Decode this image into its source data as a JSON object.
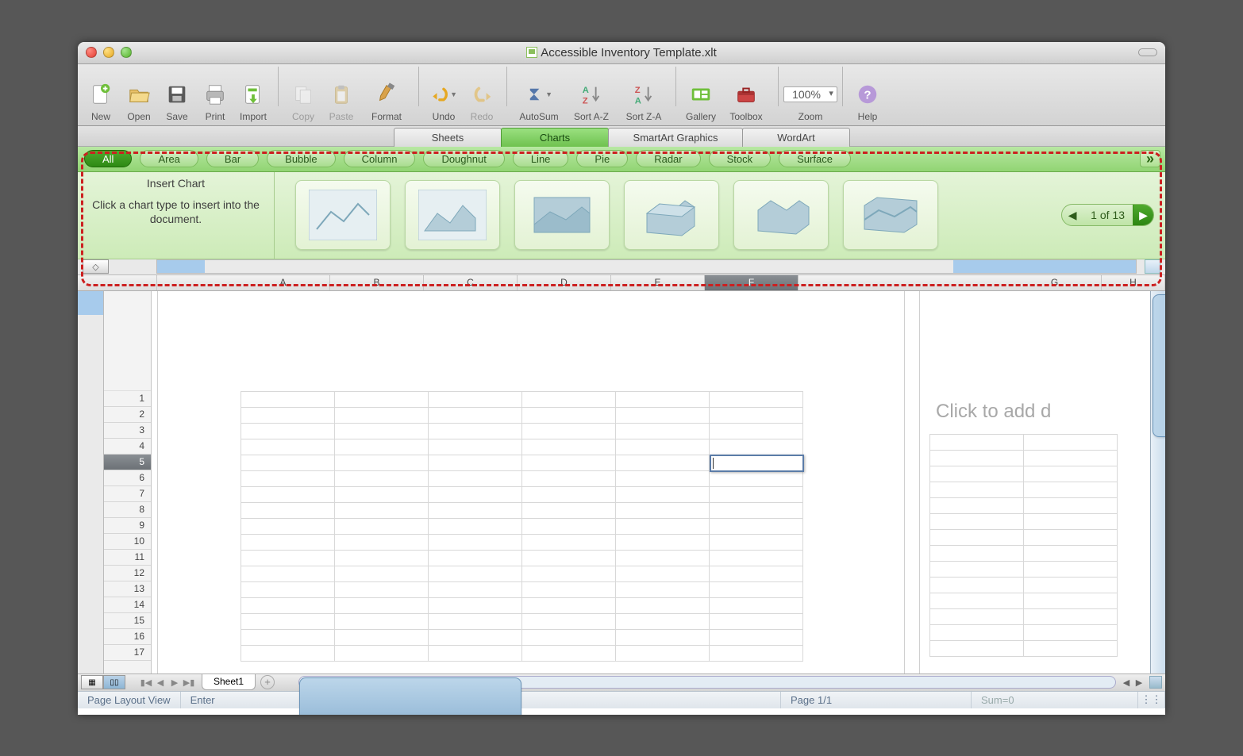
{
  "window": {
    "title": "Accessible Inventory Template.xlt"
  },
  "toolbar": {
    "new": "New",
    "open": "Open",
    "save": "Save",
    "print": "Print",
    "import": "Import",
    "copy": "Copy",
    "paste": "Paste",
    "format": "Format",
    "undo": "Undo",
    "redo": "Redo",
    "autosum": "AutoSum",
    "sort_az": "Sort A-Z",
    "sort_za": "Sort Z-A",
    "gallery": "Gallery",
    "toolbox": "Toolbox",
    "zoom": "Zoom",
    "zoom_value": "100%",
    "help": "Help"
  },
  "ribbon_tabs": [
    "Sheets",
    "Charts",
    "SmartArt Graphics",
    "WordArt"
  ],
  "ribbon_active": "Charts",
  "chart_categories": [
    "All",
    "Area",
    "Bar",
    "Bubble",
    "Column",
    "Doughnut",
    "Line",
    "Pie",
    "Radar",
    "Stock",
    "Surface"
  ],
  "chart_category_active": "All",
  "insert_chart": {
    "header": "Insert Chart",
    "description": "Click a chart type to insert into the document."
  },
  "pager": {
    "text": "1 of 13"
  },
  "columns": [
    "A",
    "B",
    "C",
    "D",
    "E",
    "F",
    "G",
    "H"
  ],
  "selected_column": "F",
  "rows": [
    "1",
    "2",
    "3",
    "4",
    "5",
    "6",
    "7",
    "8",
    "9",
    "10",
    "11",
    "12",
    "13",
    "14",
    "15",
    "16",
    "17"
  ],
  "selected_row": "5",
  "side_placeholder": "Click to add d",
  "sheet_tabs": {
    "active": "Sheet1"
  },
  "status": {
    "view": "Page Layout View",
    "mode": "Enter",
    "page": "Page 1/1",
    "sum": "Sum=0"
  }
}
